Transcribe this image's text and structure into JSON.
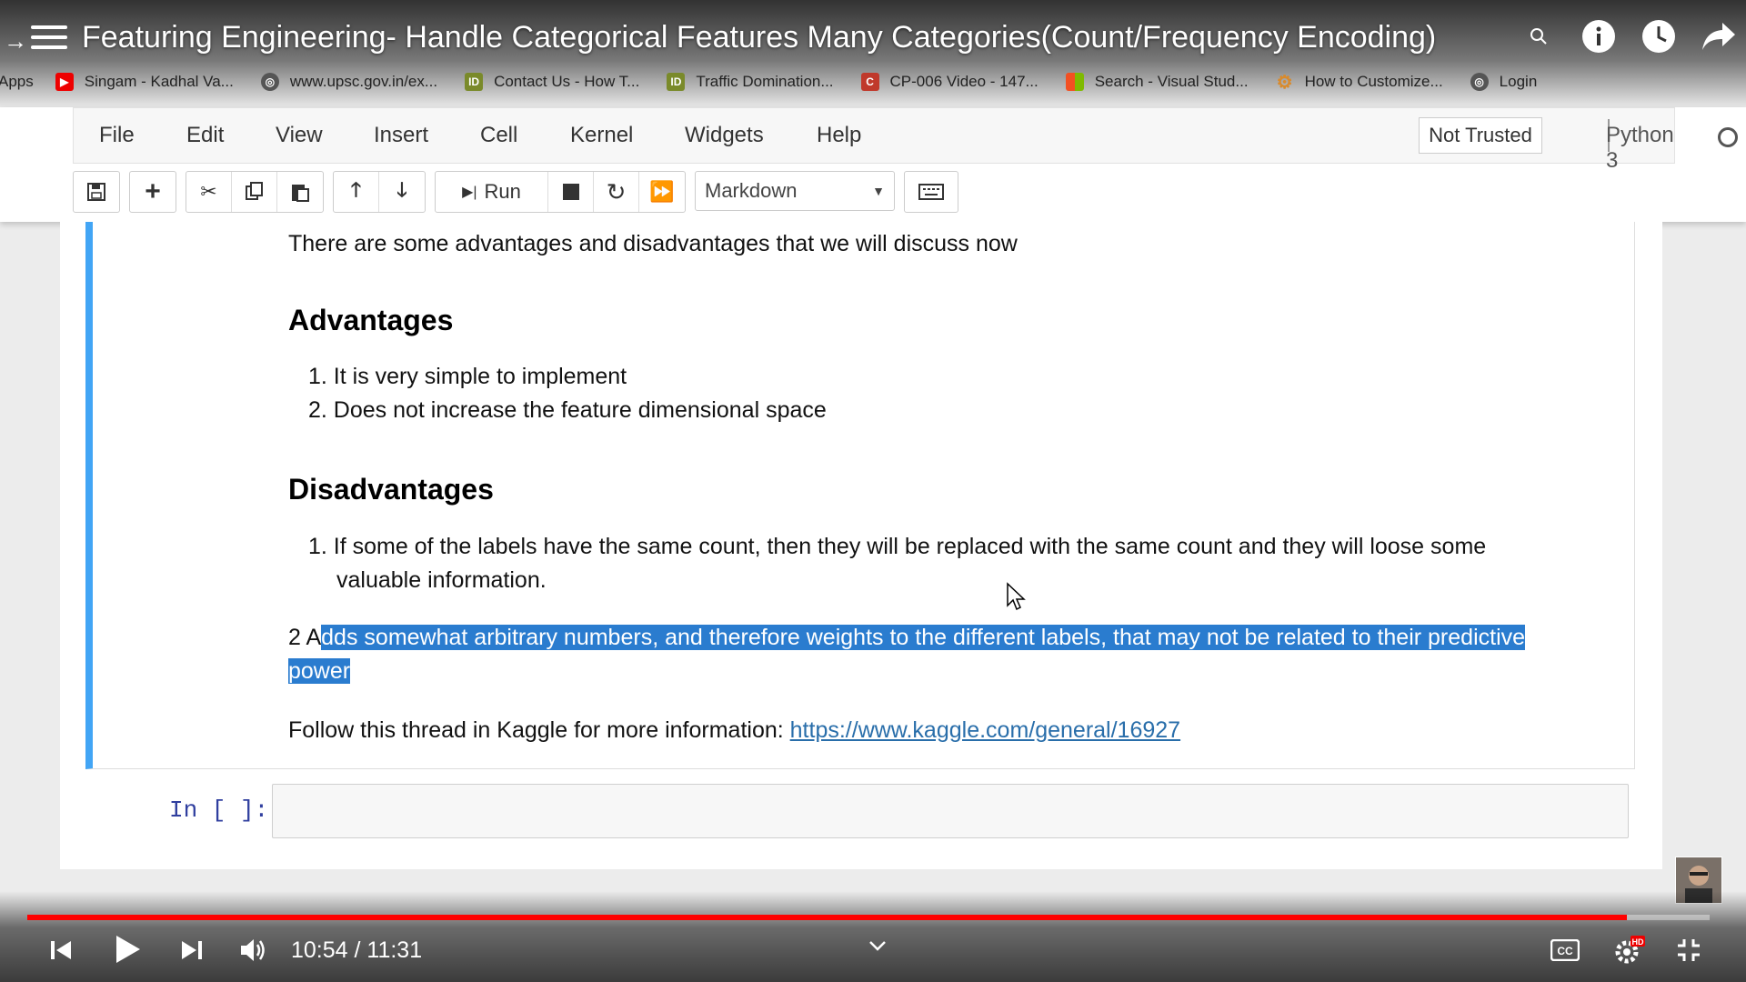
{
  "video": {
    "title": "Featuring Engineering- Handle Categorical Features Many Categories(Count/Frequency Encoding)",
    "time_current": "10:54",
    "time_sep": " / ",
    "time_total": "11:31",
    "progress": 0.951
  },
  "bookmarks": [
    {
      "label": "Apps",
      "icon": "apps-grid-icon"
    },
    {
      "label": "Singam - Kadhal Va...",
      "icon": "youtube-icon",
      "color": "#e00"
    },
    {
      "label": "www.upsc.gov.in/ex...",
      "icon": "globe-icon",
      "color": "#555"
    },
    {
      "label": "Contact Us - How T...",
      "icon": "id-icon",
      "color": "#7a8a2a"
    },
    {
      "label": "Traffic Domination...",
      "icon": "id-icon",
      "color": "#7a8a2a"
    },
    {
      "label": "CP-006 Video - 147...",
      "icon": "c-icon",
      "color": "#c0392b"
    },
    {
      "label": "Search - Visual Stud...",
      "icon": "windows-icon",
      "color": "#00a4ef"
    },
    {
      "label": "How to Customize...",
      "icon": "gear-icon",
      "color": "#d98a2b"
    },
    {
      "label": "Login",
      "icon": "globe-icon",
      "color": "#555"
    }
  ],
  "menu": {
    "file": "File",
    "edit": "Edit",
    "view": "View",
    "insert": "Insert",
    "cell": "Cell",
    "kernel": "Kernel",
    "widgets": "Widgets",
    "help": "Help",
    "not_trusted": "Not Trusted",
    "kernel_name": "Python 3"
  },
  "toolbar": {
    "run": "Run",
    "cell_type": "Markdown"
  },
  "markdown": {
    "intro": "There are some advantages and disadvantages that we will discuss now",
    "advantages_heading": "Advantages",
    "advantages": [
      "It is very simple to implement",
      "Does not increase the feature dimensional space"
    ],
    "disadvantages_heading": "Disadvantages",
    "disadvantages_1_line1": "If some of the labels have the same count, then they will be replaced with the same count and they will loose some",
    "disadvantages_1_line2": "valuable information.",
    "item2_prefix": "2 A",
    "item2_highlight_line1": "dds somewhat arbitrary numbers, and therefore weights to the different labels, that may not be related to their predictive",
    "item2_highlight_line2": "power",
    "follow_text": "Follow this thread in Kaggle for more information: ",
    "follow_link": "https://www.kaggle.com/general/16927"
  },
  "code_cell": {
    "prompt": "In [ ]:"
  },
  "colors": {
    "cell_accent": "#42a5f5",
    "selection": "#2a7ccf",
    "progress": "#ff0000",
    "link": "#296eaa"
  }
}
